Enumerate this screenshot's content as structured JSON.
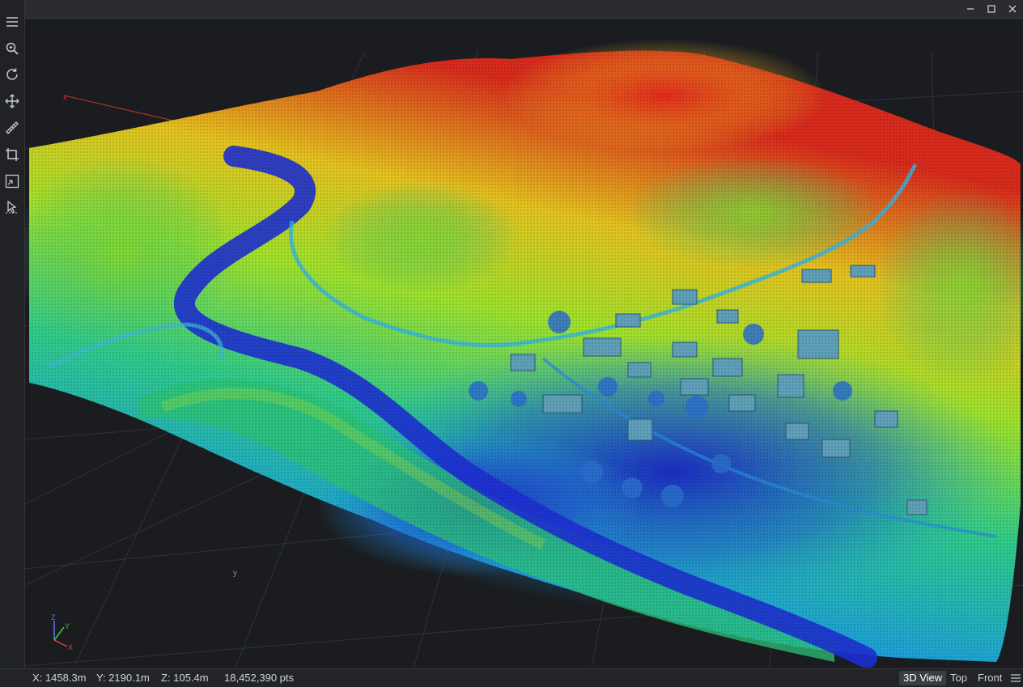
{
  "statusbar": {
    "x": "X: 1458.3m",
    "y": "Y: 2190.1m",
    "z": "Z: 105.4m",
    "points": "18,452,390 pts"
  },
  "view_tabs": [
    {
      "label": "3D View",
      "active": true
    },
    {
      "label": "Top",
      "active": false
    },
    {
      "label": "Front",
      "active": false
    }
  ],
  "axis_labels": {
    "x": "x",
    "y": "y",
    "gizmo_x": "X",
    "gizmo_y": "Y",
    "gizmo_z": "Z"
  },
  "colors": {
    "low": "#1a2cc8",
    "mid_low": "#1c9fd6",
    "mid": "#2fc98a",
    "mid_high": "#9ee02c",
    "high": "#e3c21f",
    "peak": "#d62a1c",
    "axis_x": "#e0463f",
    "axis_y": "#4fc24a",
    "axis_z": "#4a7de8"
  },
  "toolbar": {
    "items": [
      "menu-icon",
      "zoom-icon",
      "rotate-icon",
      "pan-icon",
      "measure-icon",
      "crop-icon",
      "fit-view-icon",
      "select-icon"
    ]
  }
}
